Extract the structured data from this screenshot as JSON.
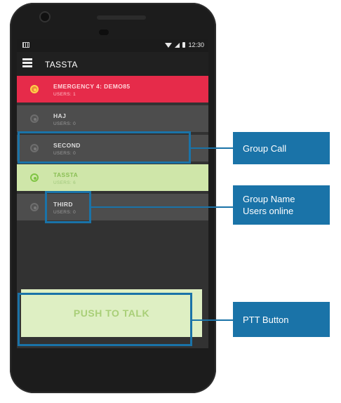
{
  "status_bar": {
    "time": "12:30"
  },
  "app_bar": {
    "title": "TASSTA"
  },
  "groups": [
    {
      "name": "EMERGENCY 4: DEMO85",
      "users": "USERS: 1"
    },
    {
      "name": "HAJ",
      "users": "USERS: 0"
    },
    {
      "name": "SECOND",
      "users": "USERS: 0"
    },
    {
      "name": "TASSTA",
      "users": "USERS: 6"
    },
    {
      "name": "THIRD",
      "users": "USERS: 0"
    }
  ],
  "ptt_label": "PUSH TO TALK",
  "annotations": {
    "group_call": "Group Call",
    "group_name_line1": "Group Name",
    "group_name_line2": "Users online",
    "ptt_button": "PTT Button"
  },
  "colors": {
    "emergency": "#e62b4a",
    "active_group": "#cfe6a9",
    "annotation_blue": "#1a73a8",
    "ptt_button": "#deefc3"
  }
}
